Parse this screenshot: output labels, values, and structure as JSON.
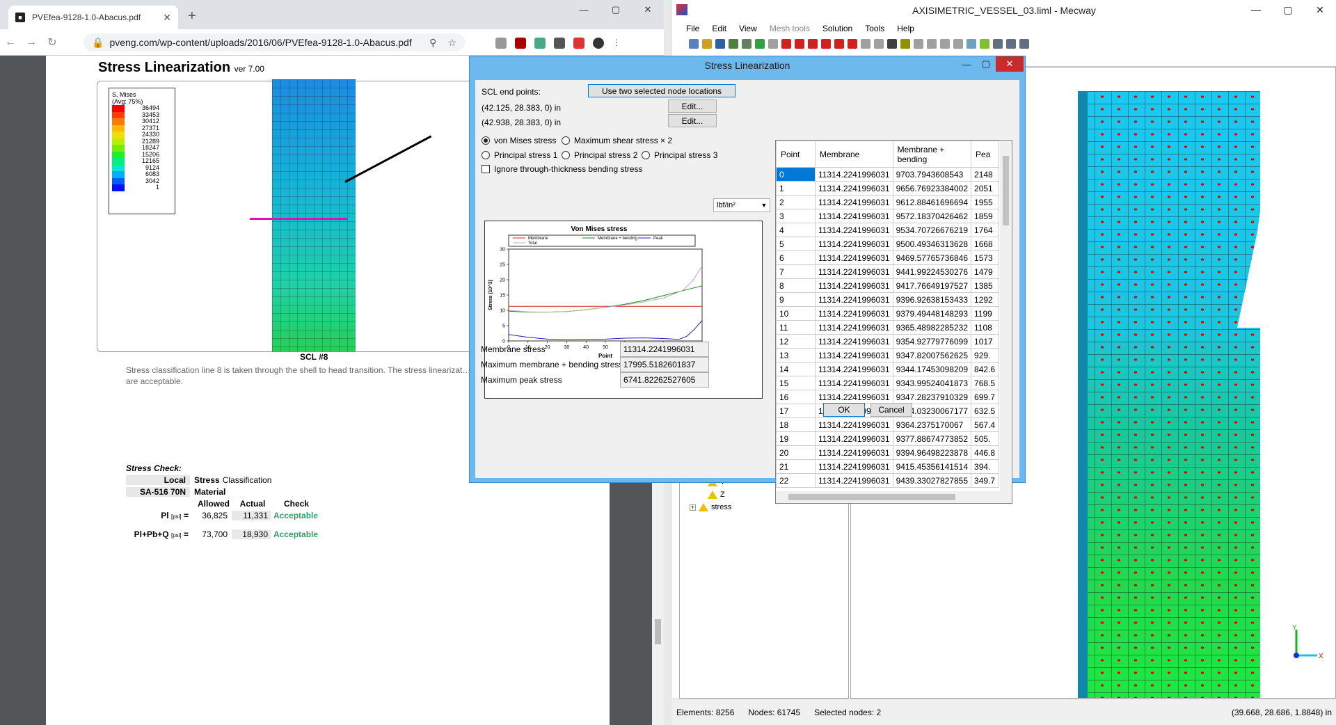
{
  "browser": {
    "tab_title": "PVEfea-9128-1.0-Abacus.pdf",
    "tab_close": "✕",
    "new_tab": "+",
    "url": "pveng.com/wp-content/uploads/2016/06/PVEfea-9128-1.0-Abacus.pdf",
    "min": "—",
    "max": "▢",
    "close": "✕"
  },
  "pdf": {
    "heading": "Stress Linearization",
    "version": "ver 7.00",
    "legend_title": "S, Mises",
    "legend_avg": "(Avg: 75%)",
    "legend_values": [
      "36494",
      "33453",
      "30412",
      "27371",
      "24330",
      "21289",
      "18247",
      "15206",
      "12165",
      "9124",
      "6083",
      "3042",
      "1"
    ],
    "legend_colors": [
      "#ff0000",
      "#ff3d00",
      "#ff7a00",
      "#ffb800",
      "#f0e000",
      "#b8f000",
      "#70f000",
      "#20f020",
      "#00f080",
      "#00e8d0",
      "#00b0ff",
      "#0060ff",
      "#0010ff"
    ],
    "scl_label": "SCL #8",
    "paragraph": "Stress classification line 8 is taken through the shell to head transition.  The stress linearizat… the material stress allowables and are acceptable.",
    "check_title": "Stress Check:",
    "local": "Local",
    "stress": "Stress",
    "classification": "Classification",
    "sa516": "SA-516 70N",
    "material": "Material",
    "allowed": "Allowed",
    "actual": "Actual",
    "check": "Check",
    "pl_label": "Pl",
    "pl_unit": "[psi]",
    "pl_allowed": "36,825",
    "pl_actual": "11,331",
    "pl_check": "Acceptable",
    "plpb_label": "Pl+Pb+Q",
    "plpb_unit": "[psi]",
    "plpb_allowed": "73,700",
    "plpb_actual": "18,930",
    "plpb_check": "Acceptable"
  },
  "mecway": {
    "title": "AXISIMETRIC_VESSEL_03.liml - Mecway",
    "menu": [
      "File",
      "Edit",
      "View",
      "Mesh tools",
      "Solution",
      "Tools",
      "Help"
    ],
    "tree_items": [
      "Y",
      "Z",
      "stress"
    ],
    "status_elements": "Elements: 8256",
    "status_nodes": "Nodes: 61745",
    "status_selected": "Selected nodes: 2",
    "status_coords": "(39.668, 28.686, 1.8848) in",
    "axis_x": "X",
    "axis_y": "Y"
  },
  "dialog": {
    "title": "Stress Linearization",
    "scl_end_points": "SCL end points:",
    "use_two_nodes": "Use two selected node locations",
    "point1": "(42.125, 28.383, 0) in",
    "point2": "(42.938, 28.383, 0) in",
    "edit": "Edit...",
    "radios": [
      "von Mises stress",
      "Maximum shear stress × 2",
      "Principal stress 1",
      "Principal stress 2",
      "Principal stress 3"
    ],
    "unit": "lbf/in²",
    "ignore_bending": "Ignore through-thickness bending stress",
    "membrane_label": "Membrane stress",
    "membrane_value": "11314.2241996031",
    "mb_label": "Maximum membrane + bending stress",
    "mb_value": "17995.5182601837",
    "peak_label": "Maximum peak stress",
    "peak_value": "6741.82262527605",
    "ok": "OK",
    "cancel": "Cancel",
    "table_headers": [
      "Point",
      "Membrane",
      "Membrane + bending",
      "Pea"
    ],
    "rows": [
      [
        "0",
        "11314.2241996031",
        "9703.7943608543",
        "2148"
      ],
      [
        "1",
        "11314.2241996031",
        "9656.76923384002",
        "2051"
      ],
      [
        "2",
        "11314.2241996031",
        "9612.88461696694",
        "1955"
      ],
      [
        "3",
        "11314.2241996031",
        "9572.18370426462",
        "1859"
      ],
      [
        "4",
        "11314.2241996031",
        "9534.70726676219",
        "1764"
      ],
      [
        "5",
        "11314.2241996031",
        "9500.49346313628",
        "1668"
      ],
      [
        "6",
        "11314.2241996031",
        "9469.57765736846",
        "1573"
      ],
      [
        "7",
        "11314.2241996031",
        "9441.99224530276",
        "1479"
      ],
      [
        "8",
        "11314.2241996031",
        "9417.76649197527",
        "1385"
      ],
      [
        "9",
        "11314.2241996031",
        "9396.92638153433",
        "1292"
      ],
      [
        "10",
        "11314.2241996031",
        "9379.49448148293",
        "1199"
      ],
      [
        "11",
        "11314.2241996031",
        "9365.48982285232",
        "1108"
      ],
      [
        "12",
        "11314.2241996031",
        "9354.92779776099",
        "1017"
      ],
      [
        "13",
        "11314.2241996031",
        "9347.82007562625",
        "929."
      ],
      [
        "14",
        "11314.2241996031",
        "9344.17453098209",
        "842.6"
      ],
      [
        "15",
        "11314.2241996031",
        "9343.99524041873",
        "768.5"
      ],
      [
        "16",
        "11314.2241996031",
        "9347.28237910329",
        "699.7"
      ],
      [
        "17",
        "11314.2241996031",
        "9354.03230067177",
        "632.5"
      ],
      [
        "18",
        "11314.2241996031",
        "9364.2375170067",
        "567.4"
      ],
      [
        "19",
        "11314.2241996031",
        "9377.88674773852",
        "505."
      ],
      [
        "20",
        "11314.2241996031",
        "9394.96498223878",
        "446.8"
      ],
      [
        "21",
        "11314.2241996031",
        "9415.45356141514",
        "394."
      ],
      [
        "22",
        "11314.2241996031",
        "9439.33027827855",
        "349.7"
      ]
    ]
  },
  "chart_data": {
    "type": "line",
    "title": "Von Mises stress",
    "xlabel": "Point",
    "ylabel": "Stress (10^3)",
    "xlim": [
      0,
      100
    ],
    "ylim": [
      0,
      30
    ],
    "xticks": [
      0,
      10,
      20,
      30,
      40,
      50,
      60,
      70,
      80,
      90,
      100
    ],
    "yticks": [
      0,
      5,
      10,
      15,
      20,
      25,
      30
    ],
    "legend_position": "top",
    "series": [
      {
        "name": "Membrane",
        "color": "#e02020",
        "x": [
          0,
          100
        ],
        "y": [
          11.3,
          11.3
        ]
      },
      {
        "name": "Membrane + bending",
        "color": "#208020",
        "x": [
          0,
          10,
          20,
          30,
          40,
          50,
          60,
          70,
          80,
          90,
          100
        ],
        "y": [
          9.7,
          9.4,
          9.4,
          9.6,
          10.2,
          11.0,
          12.0,
          13.2,
          14.8,
          16.4,
          18.0
        ]
      },
      {
        "name": "Peak",
        "color": "#2020c0",
        "x": [
          0,
          10,
          20,
          30,
          40,
          50,
          60,
          70,
          80,
          88,
          92,
          96,
          100
        ],
        "y": [
          2.1,
          1.2,
          0.6,
          0.4,
          0.5,
          0.6,
          0.9,
          1.0,
          0.8,
          0.5,
          1.5,
          3.8,
          6.7
        ]
      },
      {
        "name": "Total",
        "color": "#b0b0b0",
        "x": [
          0,
          10,
          20,
          30,
          40,
          50,
          60,
          70,
          80,
          90,
          95,
          100
        ],
        "y": [
          10.0,
          9.5,
          9.4,
          9.6,
          10.2,
          11.0,
          11.8,
          12.8,
          14.0,
          16.5,
          19.5,
          24.5
        ]
      }
    ]
  }
}
